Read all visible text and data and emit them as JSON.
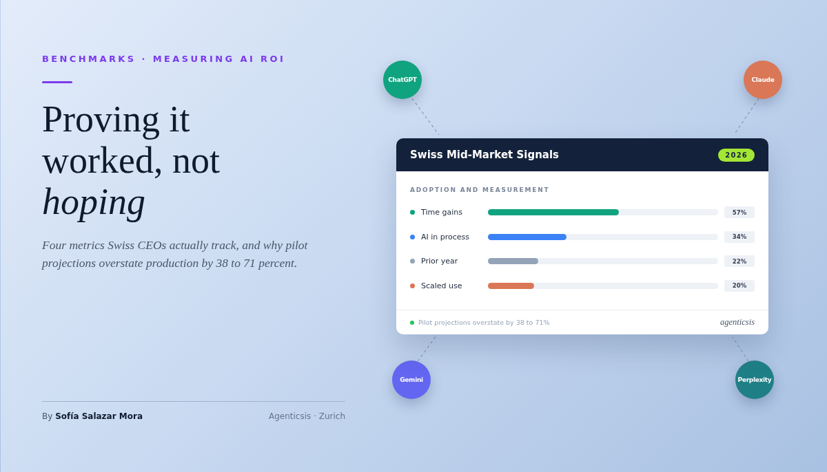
{
  "eyebrow": "BENCHMARKS · MEASURING AI ROI",
  "headline": "Proving it worked, not *hoping*",
  "subtitle": "Four metrics Swiss CEOs actually track, and why pilot projections overstate production by 38 to 71 percent.",
  "byline": {
    "prefix": "By",
    "author": "Sofía Salazar Mora",
    "place": "Agenticsis · Zurich"
  },
  "nodes": [
    {
      "label": "ChatGPT",
      "color": "#10a37f"
    },
    {
      "label": "Claude",
      "color": "#d97757"
    },
    {
      "label": "Gemini",
      "color": "#6366f1"
    },
    {
      "label": "Perplexity",
      "color": "#1f7f87"
    }
  ],
  "card": {
    "title": "Swiss Mid-Market Signals",
    "badge": "2026",
    "section": "ADOPTION AND MEASUREMENT",
    "metrics": [
      {
        "label": "Time gains",
        "color": "#10a37f",
        "level": 0.57,
        "reading": "57%"
      },
      {
        "label": "AI in process",
        "color": "#3b82f6",
        "level": 0.34,
        "reading": "34%"
      },
      {
        "label": "Prior year",
        "color": "#94a3b8",
        "level": 0.22,
        "reading": "22%"
      },
      {
        "label": "Scaled use",
        "color": "#d97757",
        "level": 0.2,
        "reading": "20%"
      }
    ],
    "footer": {
      "note": "Pilot projections overstate by 38 to 71%",
      "color": "#22c55e",
      "brand": "agenticsis"
    }
  }
}
